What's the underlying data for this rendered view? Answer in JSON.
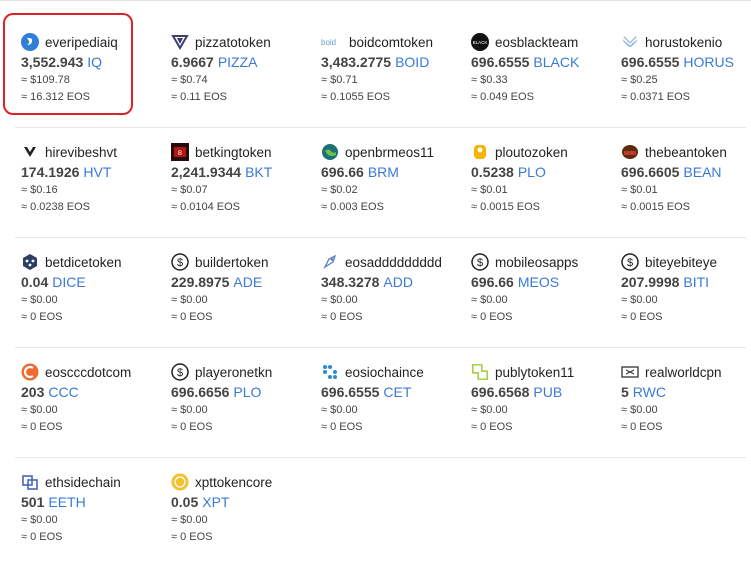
{
  "tokens": [
    {
      "name": "everipediaiq",
      "amount": "3,552.943",
      "symbol": "IQ",
      "usd": "≈ $109.78",
      "eos": "≈ 16.312 EOS",
      "icon": "everipedia-logo-icon"
    },
    {
      "name": "pizzatotoken",
      "amount": "6.9667",
      "symbol": "PIZZA",
      "usd": "≈ $0.74",
      "eos": "≈ 0.11 EOS",
      "icon": "pizza-logo-icon"
    },
    {
      "name": "boidcomtoken",
      "amount": "3,483.2775",
      "symbol": "BOID",
      "usd": "≈ $0.71",
      "eos": "≈ 0.1055 EOS",
      "icon": "boid-logo-icon",
      "icon_text": "boid"
    },
    {
      "name": "eosblackteam",
      "amount": "696.6555",
      "symbol": "BLACK",
      "usd": "≈ $0.33",
      "eos": "≈ 0.049 EOS",
      "icon": "eosblack-logo-icon",
      "icon_text": "BLACK"
    },
    {
      "name": "horustokenio",
      "amount": "696.6555",
      "symbol": "HORUS",
      "usd": "≈ $0.25",
      "eos": "≈ 0.0371 EOS",
      "icon": "horus-wings-icon"
    },
    {
      "name": "hirevibeshvt",
      "amount": "174.1926",
      "symbol": "HVT",
      "usd": "≈ $0.16",
      "eos": "≈ 0.0238 EOS",
      "icon": "hirevibes-logo-icon"
    },
    {
      "name": "betkingtoken",
      "amount": "2,241.9344",
      "symbol": "BKT",
      "usd": "≈ $0.07",
      "eos": "≈ 0.0104 EOS",
      "icon": "betking-logo-icon"
    },
    {
      "name": "openbrmeos11",
      "amount": "696.66",
      "symbol": "BRM",
      "usd": "≈ $0.02",
      "eos": "≈ 0.003 EOS",
      "icon": "openbrm-globe-icon"
    },
    {
      "name": "ploutozoken",
      "amount": "0.5238",
      "symbol": "PLO",
      "usd": "≈ $0.01",
      "eos": "≈ 0.0015 EOS",
      "icon": "plouto-logo-icon"
    },
    {
      "name": "thebeantoken",
      "amount": "696.6605",
      "symbol": "BEAN",
      "usd": "≈ $0.01",
      "eos": "≈ 0.0015 EOS",
      "icon": "bean-logo-icon"
    },
    {
      "name": "betdicetoken",
      "amount": "0.04",
      "symbol": "DICE",
      "usd": "≈ $0.00",
      "eos": "≈ 0 EOS",
      "icon": "betdice-logo-icon"
    },
    {
      "name": "buildertoken",
      "amount": "229.8975",
      "symbol": "ADE",
      "usd": "≈ $0.00",
      "eos": "≈ 0 EOS",
      "icon": "dollar-circle-icon"
    },
    {
      "name": "eosaddddddddd",
      "amount": "348.3278",
      "symbol": "ADD",
      "usd": "≈ $0.00",
      "eos": "≈ 0 EOS",
      "icon": "eosadd-rocket-icon"
    },
    {
      "name": "mobileosapps",
      "amount": "696.66",
      "symbol": "MEOS",
      "usd": "≈ $0.00",
      "eos": "≈ 0 EOS",
      "icon": "dollar-circle-icon"
    },
    {
      "name": "biteyebiteye",
      "amount": "207.9998",
      "symbol": "BITI",
      "usd": "≈ $0.00",
      "eos": "≈ 0 EOS",
      "icon": "dollar-circle-icon"
    },
    {
      "name": "eoscccdotcom",
      "amount": "203",
      "symbol": "CCC",
      "usd": "≈ $0.00",
      "eos": "≈ 0 EOS",
      "icon": "eosccc-logo-icon"
    },
    {
      "name": "playeronetkn",
      "amount": "696.6656",
      "symbol": "PLO",
      "usd": "≈ $0.00",
      "eos": "≈ 0 EOS",
      "icon": "dollar-circle-icon"
    },
    {
      "name": "eosiochaince",
      "amount": "696.6555",
      "symbol": "CET",
      "usd": "≈ $0.00",
      "eos": "≈ 0 EOS",
      "icon": "eosiochaince-dots-icon"
    },
    {
      "name": "publytoken11",
      "amount": "696.6568",
      "symbol": "PUB",
      "usd": "≈ $0.00",
      "eos": "≈ 0 EOS",
      "icon": "publy-logo-icon"
    },
    {
      "name": "realworldcpn",
      "amount": "5",
      "symbol": "RWC",
      "usd": "≈ $0.00",
      "eos": "≈ 0 EOS",
      "icon": "realworld-coupon-icon"
    },
    {
      "name": "ethsidechain",
      "amount": "501",
      "symbol": "EETH",
      "usd": "≈ $0.00",
      "eos": "≈ 0 EOS",
      "icon": "ethsidechain-logo-icon"
    },
    {
      "name": "xpttokencore",
      "amount": "0.05",
      "symbol": "XPT",
      "usd": "≈ $0.00",
      "eos": "≈ 0 EOS",
      "icon": "xpt-coin-icon"
    }
  ],
  "colors": {
    "accent": "#3a7ad6",
    "highlight": "#d9232a",
    "separator": "#e6e6e6"
  }
}
